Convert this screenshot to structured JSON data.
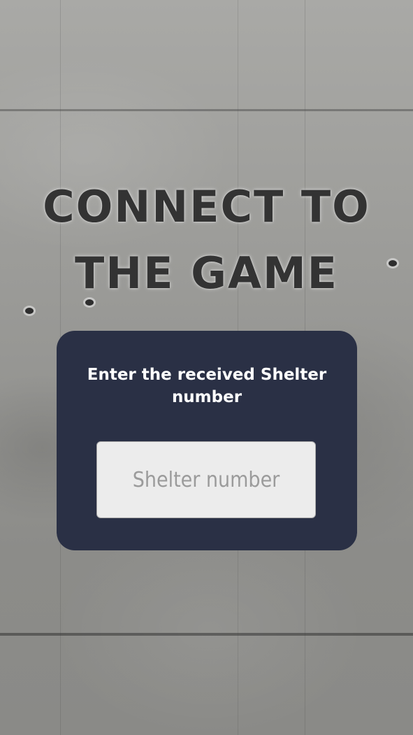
{
  "title": {
    "line1": "CONNECT TO",
    "line2": "THE GAME"
  },
  "card": {
    "prompt": "Enter the received Shelter number",
    "input_placeholder": "Shelter number",
    "input_value": ""
  },
  "colors": {
    "card_background": "#2a3045",
    "title_text": "#333333",
    "prompt_text": "#ffffff",
    "input_background": "#ececec",
    "placeholder_text": "#9b9b9b"
  }
}
